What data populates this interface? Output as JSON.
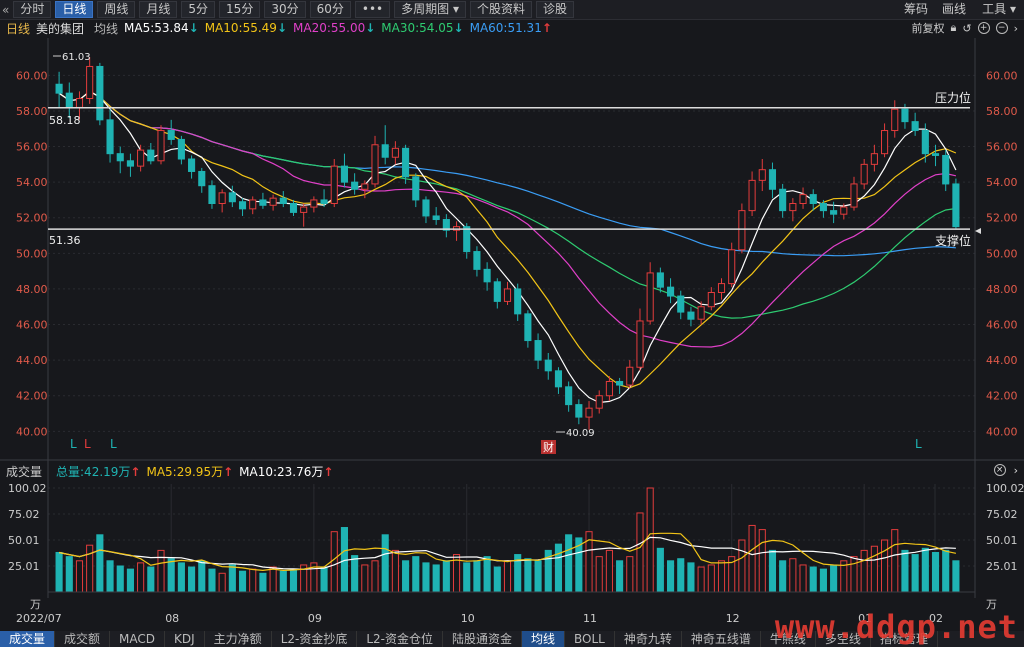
{
  "toolbar": {
    "back_icon": "«",
    "tabs": [
      "分时",
      "日线",
      "周线",
      "月线",
      "5分",
      "15分",
      "30分",
      "60分",
      "•••",
      "多周期图 ▾",
      "个股资料",
      "诊股"
    ],
    "active_tab": 1,
    "right": [
      "筹码",
      "画线",
      "工具 ▾"
    ]
  },
  "info": {
    "period": "日线",
    "name": "美的集团",
    "ma_label": "均线",
    "ma5": "MA5:53.84",
    "ma10": "MA10:55.49",
    "ma20": "MA20:55.00",
    "ma30": "MA30:54.05",
    "ma60": "MA60:51.31",
    "fuquan": "前复权",
    "colors": {
      "ma5": "#ffffff",
      "ma10": "#f2c417",
      "ma20": "#e040c8",
      "ma30": "#2ecc71",
      "ma60": "#3a9df5",
      "up": "#e33c3c",
      "down": "#1fb3b3"
    }
  },
  "annotations": {
    "resistance_label": "压力位",
    "support_label": "支撑位",
    "resistance_value": "58.18",
    "support_value": "51.36",
    "high_label": "61.03",
    "low_label": "40.09",
    "cai_badge": "财",
    "l_marks": [
      "L",
      "L",
      "L",
      "L"
    ]
  },
  "volume": {
    "title": "成交量",
    "total": "总量:42.19万",
    "ma5": "MA5:29.95万",
    "ma10": "MA10:23.76万",
    "unit": "万"
  },
  "bottom_tabs": [
    "成交量",
    "成交额",
    "MACD",
    "KDJ",
    "主力净额",
    "L2-资金抄底",
    "L2-资金仓位",
    "陆股通资金",
    "均线",
    "BOLL",
    "神奇九转",
    "神奇五线谱",
    "牛熊线",
    "多空线",
    "指标管理"
  ],
  "watermark": "www.ddgp.net",
  "chart_data": {
    "type": "candlestick",
    "price_ticks": [
      "60.00",
      "58.00",
      "56.00",
      "54.00",
      "52.00",
      "50.00",
      "48.00",
      "46.00",
      "44.00",
      "42.00",
      "40.00"
    ],
    "price_ylim": [
      39.4,
      61.2
    ],
    "volume_ticks": [
      "100.02",
      "75.02",
      "50.01",
      "25.01"
    ],
    "volume_ylim": [
      0,
      100
    ],
    "x_labels": [
      "2022/07",
      "08",
      "09",
      "10",
      "11",
      "12",
      "01",
      "02"
    ],
    "resistance": 58.18,
    "support": 51.36,
    "ma_end": {
      "MA5": 53.84,
      "MA10": 55.49,
      "MA20": 55.0,
      "MA30": 54.05,
      "MA60": 51.31
    },
    "candles": [
      [
        59.5,
        60.2,
        58.2,
        59.0
      ],
      [
        59.0,
        59.6,
        57.6,
        58.2
      ],
      [
        58.2,
        59.1,
        57.5,
        58.7
      ],
      [
        58.7,
        61.03,
        58.4,
        60.5
      ],
      [
        60.5,
        60.7,
        57.2,
        57.5
      ],
      [
        57.5,
        58.1,
        55.1,
        55.6
      ],
      [
        55.6,
        56.0,
        54.5,
        55.2
      ],
      [
        55.2,
        55.6,
        54.3,
        54.9
      ],
      [
        54.9,
        56.1,
        54.6,
        55.8
      ],
      [
        55.8,
        56.2,
        55.0,
        55.2
      ],
      [
        55.2,
        57.2,
        55.0,
        56.9
      ],
      [
        56.9,
        57.5,
        56.1,
        56.4
      ],
      [
        56.4,
        56.6,
        55.0,
        55.3
      ],
      [
        55.3,
        55.5,
        54.2,
        54.6
      ],
      [
        54.6,
        54.8,
        53.4,
        53.8
      ],
      [
        53.8,
        54.1,
        52.5,
        52.8
      ],
      [
        52.8,
        53.6,
        52.3,
        53.4
      ],
      [
        53.4,
        53.8,
        52.6,
        52.9
      ],
      [
        52.9,
        53.1,
        52.1,
        52.5
      ],
      [
        52.5,
        53.2,
        52.2,
        53.0
      ],
      [
        53.0,
        53.4,
        52.5,
        52.7
      ],
      [
        52.7,
        53.3,
        52.4,
        53.1
      ],
      [
        53.1,
        53.5,
        52.6,
        52.8
      ],
      [
        52.8,
        53.0,
        52.1,
        52.3
      ],
      [
        52.3,
        52.8,
        51.5,
        52.6
      ],
      [
        52.6,
        53.2,
        52.3,
        53.0
      ],
      [
        53.0,
        53.6,
        52.6,
        52.8
      ],
      [
        52.8,
        55.3,
        52.6,
        54.9
      ],
      [
        54.9,
        55.6,
        53.7,
        54.0
      ],
      [
        54.0,
        54.5,
        53.3,
        53.6
      ],
      [
        53.6,
        54.1,
        53.1,
        53.9
      ],
      [
        53.9,
        56.6,
        53.7,
        56.1
      ],
      [
        56.1,
        57.2,
        55.0,
        55.4
      ],
      [
        55.4,
        56.3,
        55.0,
        55.9
      ],
      [
        55.9,
        56.1,
        53.9,
        54.3
      ],
      [
        54.3,
        54.5,
        52.6,
        53.0
      ],
      [
        53.0,
        53.2,
        51.7,
        52.1
      ],
      [
        52.1,
        52.6,
        51.6,
        51.9
      ],
      [
        51.9,
        52.2,
        50.9,
        51.3
      ],
      [
        51.3,
        51.8,
        50.7,
        51.5
      ],
      [
        51.5,
        51.7,
        49.7,
        50.1
      ],
      [
        50.1,
        50.4,
        48.7,
        49.1
      ],
      [
        49.1,
        49.5,
        47.9,
        48.4
      ],
      [
        48.4,
        48.6,
        46.9,
        47.3
      ],
      [
        47.3,
        48.4,
        47.1,
        48.0
      ],
      [
        48.0,
        48.3,
        46.2,
        46.6
      ],
      [
        46.6,
        46.8,
        44.7,
        45.1
      ],
      [
        45.1,
        45.5,
        43.5,
        44.0
      ],
      [
        44.0,
        44.4,
        42.9,
        43.4
      ],
      [
        43.4,
        43.6,
        42.1,
        42.5
      ],
      [
        42.5,
        42.8,
        41.1,
        41.5
      ],
      [
        41.5,
        41.8,
        40.4,
        40.8
      ],
      [
        40.8,
        41.7,
        40.09,
        41.3
      ],
      [
        41.3,
        42.3,
        41.0,
        42.0
      ],
      [
        42.0,
        43.1,
        41.7,
        42.8
      ],
      [
        42.8,
        43.0,
        42.1,
        42.6
      ],
      [
        42.6,
        44.0,
        42.4,
        43.6
      ],
      [
        43.6,
        46.9,
        43.4,
        46.2
      ],
      [
        46.2,
        49.5,
        46.0,
        48.9
      ],
      [
        48.9,
        49.2,
        47.8,
        48.1
      ],
      [
        48.1,
        48.6,
        47.2,
        47.6
      ],
      [
        47.6,
        47.9,
        46.3,
        46.7
      ],
      [
        46.7,
        47.0,
        45.9,
        46.3
      ],
      [
        46.3,
        47.3,
        46.0,
        47.0
      ],
      [
        47.0,
        48.1,
        46.8,
        47.8
      ],
      [
        47.8,
        48.6,
        47.4,
        48.3
      ],
      [
        48.3,
        50.6,
        48.1,
        50.2
      ],
      [
        50.2,
        52.8,
        50.0,
        52.4
      ],
      [
        52.4,
        54.6,
        52.1,
        54.1
      ],
      [
        54.1,
        55.3,
        53.5,
        54.7
      ],
      [
        54.7,
        55.1,
        53.1,
        53.6
      ],
      [
        53.6,
        53.9,
        52.0,
        52.4
      ],
      [
        52.4,
        53.1,
        51.8,
        52.8
      ],
      [
        52.8,
        53.7,
        52.5,
        53.3
      ],
      [
        53.3,
        53.6,
        52.4,
        52.8
      ],
      [
        52.8,
        53.0,
        52.0,
        52.4
      ],
      [
        52.4,
        52.9,
        51.7,
        52.2
      ],
      [
        52.2,
        52.8,
        51.9,
        52.6
      ],
      [
        52.6,
        54.3,
        52.4,
        53.9
      ],
      [
        53.9,
        55.3,
        53.6,
        55.0
      ],
      [
        55.0,
        56.1,
        54.6,
        55.6
      ],
      [
        55.6,
        57.3,
        55.4,
        56.9
      ],
      [
        56.9,
        58.6,
        56.5,
        58.1
      ],
      [
        58.1,
        58.4,
        57.0,
        57.4
      ],
      [
        57.4,
        57.9,
        56.6,
        56.9
      ],
      [
        56.9,
        57.3,
        55.1,
        55.6
      ],
      [
        55.6,
        56.1,
        54.9,
        55.5
      ],
      [
        55.5,
        55.8,
        53.5,
        53.9
      ],
      [
        53.9,
        54.2,
        51.4,
        51.5
      ]
    ],
    "volumes": [
      38,
      34,
      30,
      45,
      55,
      30,
      25,
      22,
      28,
      24,
      40,
      32,
      28,
      24,
      30,
      22,
      18,
      26,
      20,
      22,
      18,
      24,
      20,
      22,
      26,
      28,
      24,
      58,
      62,
      35,
      26,
      30,
      55,
      40,
      30,
      34,
      28,
      26,
      30,
      36,
      28,
      30,
      34,
      24,
      30,
      36,
      32,
      30,
      40,
      46,
      55,
      52,
      58,
      34,
      40,
      30,
      34,
      76,
      100,
      42,
      30,
      32,
      28,
      24,
      26,
      30,
      34,
      50,
      64,
      60,
      40,
      30,
      32,
      26,
      24,
      22,
      26,
      30,
      34,
      40,
      44,
      50,
      60,
      40,
      36,
      42,
      38,
      40,
      30,
      42
    ]
  }
}
